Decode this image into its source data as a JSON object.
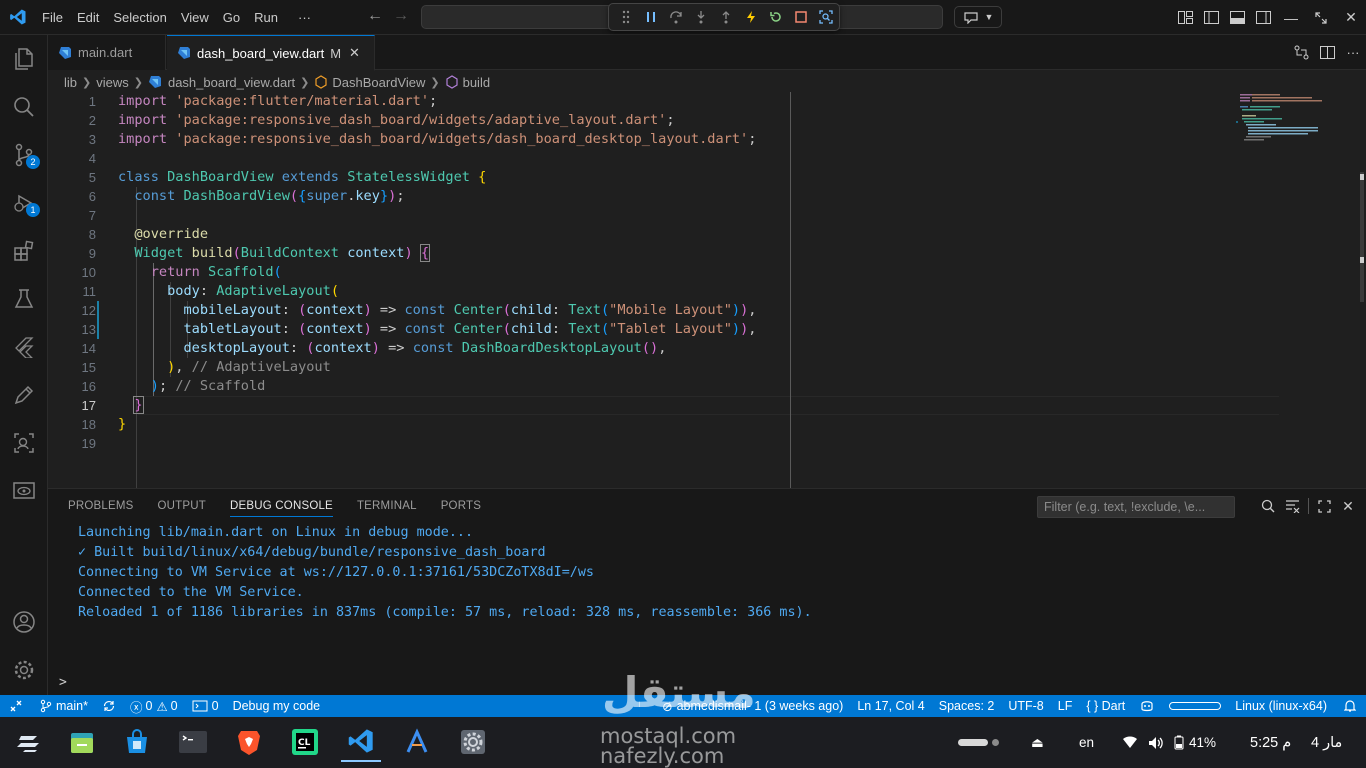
{
  "menu": {
    "items": [
      "File",
      "Edit",
      "Selection",
      "View",
      "Go",
      "Run"
    ],
    "more": "···"
  },
  "tabs": [
    {
      "label": "main.dart",
      "active": false
    },
    {
      "label": "dash_board_view.dart",
      "modified": "M",
      "active": true
    }
  ],
  "breadcrumb": [
    "lib",
    "views",
    "dash_board_view.dart",
    "DashBoardView",
    "build"
  ],
  "editor": {
    "line_numbers": [
      "1",
      "2",
      "3",
      "4",
      "5",
      "6",
      "7",
      "8",
      "9",
      "10",
      "11",
      "12",
      "13",
      "14",
      "15",
      "16",
      "17",
      "18",
      "19"
    ],
    "code": {
      "l1_kw": "import",
      "l1_str": "'package:flutter/material.dart'",
      "semi": ";",
      "l2_kw": "import",
      "l2_str": "'package:responsive_dash_board/widgets/adaptive_layout.dart'",
      "l3_kw": "import",
      "l3_str": "'package:responsive_dash_board/widgets/dash_board_desktop_layout.dart'",
      "l5_class": "class",
      "l5_name": "DashBoardView",
      "l5_extends": "extends",
      "l5_super": "StatelessWidget",
      "l6_const": "const",
      "l6_name": "DashBoardView",
      "l6_super": "super",
      "l6_key": "key",
      "l8_ann": "@override",
      "l9_type": "Widget",
      "l9_fn": "build",
      "l9_ptype": "BuildContext",
      "l9_param": "context",
      "l10_return": "return",
      "l10_cls": "Scaffold",
      "l11_prop": "body",
      "l11_cls": "AdaptiveLayout",
      "l12_prop": "mobileLayout",
      "l12_param": "context",
      "l12_const": "const",
      "l12_center": "Center",
      "l12_child": "child",
      "l12_text": "Text",
      "l12_str": "\"Mobile Layout\"",
      "l13_prop": "tabletLayout",
      "l13_param": "context",
      "l13_const": "const",
      "l13_center": "Center",
      "l13_child": "child",
      "l13_text": "Text",
      "l13_str": "\"Tablet Layout\"",
      "l14_prop": "desktopLayout",
      "l14_param": "context",
      "l14_const": "const",
      "l14_cls": "DashBoardDesktopLayout",
      "l15_cmt": "// AdaptiveLayout",
      "l16_cmt": "// Scaffold"
    }
  },
  "panel": {
    "tabs": [
      "PROBLEMS",
      "OUTPUT",
      "DEBUG CONSOLE",
      "TERMINAL",
      "PORTS"
    ],
    "active_tab": "DEBUG CONSOLE",
    "filter_placeholder": "Filter (e.g. text, !exclude, \\e...",
    "console_lines": [
      "Launching lib/main.dart on Linux in debug mode...",
      "✓ Built build/linux/x64/debug/bundle/responsive_dash_board",
      "Connecting to VM Service at ws://127.0.0.1:37161/53DCZoTX8dI=/ws",
      "Connected to the VM Service.",
      "Reloaded 1 of 1186 libraries in 837ms (compile: 57 ms, reload: 328 ms, reassemble: 366 ms)."
    ],
    "prompt": ">"
  },
  "statusbar": {
    "branch": "main*",
    "errors": "0",
    "warnings": "0",
    "ports": "0",
    "debug": "Debug my code",
    "blame": "abmedismail- 1 (3 weeks ago)",
    "position": "Ln 17, Col 4",
    "spaces": "Spaces: 2",
    "encoding": "UTF-8",
    "eol": "LF",
    "language": "{ } Dart",
    "device": "Linux (linux-x64)"
  },
  "activity_badges": {
    "scm": "2",
    "debug": "1"
  },
  "tray": {
    "lang": "en",
    "battery": "41%",
    "time": "5:25 م",
    "date": "مار 4"
  },
  "watermark": {
    "arabic": "مستقل",
    "site1": "mostaql.com",
    "site2": "nafezly.com"
  },
  "colors": {
    "accent": "#0078d4",
    "editor_bg": "#1f1f1f",
    "chrome_bg": "#181818"
  }
}
